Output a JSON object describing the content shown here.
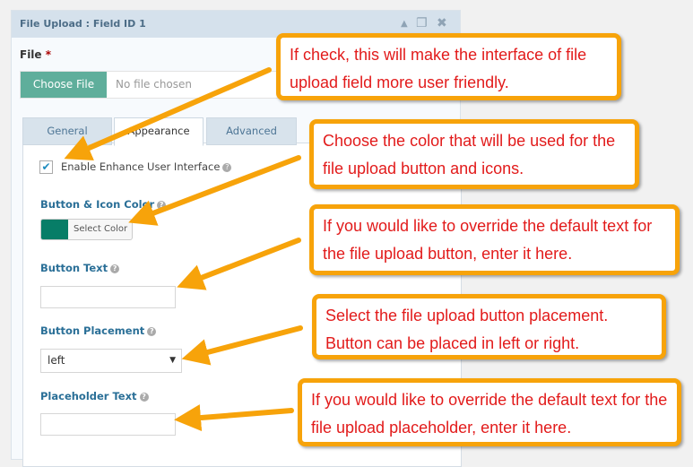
{
  "panel": {
    "title": "File Upload : Field ID 1",
    "icons": [
      "collapse-icon",
      "duplicate-icon",
      "close-icon"
    ]
  },
  "field": {
    "label": "File",
    "required": "*",
    "choose_button": "Choose File",
    "no_file": "No file chosen",
    "button_color": "#5fae9b"
  },
  "tabs": [
    {
      "label": "General"
    },
    {
      "label": "Appearance",
      "active": true
    },
    {
      "label": "Advanced"
    }
  ],
  "settings": {
    "enhance_label": "Enable Enhance User Interface",
    "enhance_checked": true,
    "color_label": "Button & Icon Color",
    "color_value": "#077d67",
    "select_color": "Select Color",
    "button_text_label": "Button Text",
    "button_text_value": "",
    "placement_label": "Button Placement",
    "placement_value": "left",
    "placeholder_label": "Placeholder Text",
    "placeholder_value": ""
  },
  "callouts": [
    "If check, this will make the interface of file upload field more user friendly.",
    "Choose the color that will be used for the file upload button and icons.",
    "If you would like to override the default text for the file upload button, enter it here.",
    "Select the file upload button placement. Button can be placed in left or right.",
    "If you would like to override the default text for the file upload placeholder, enter it here."
  ],
  "colors": {
    "callout_border": "#f7a30a",
    "callout_text": "#e21b1b"
  }
}
